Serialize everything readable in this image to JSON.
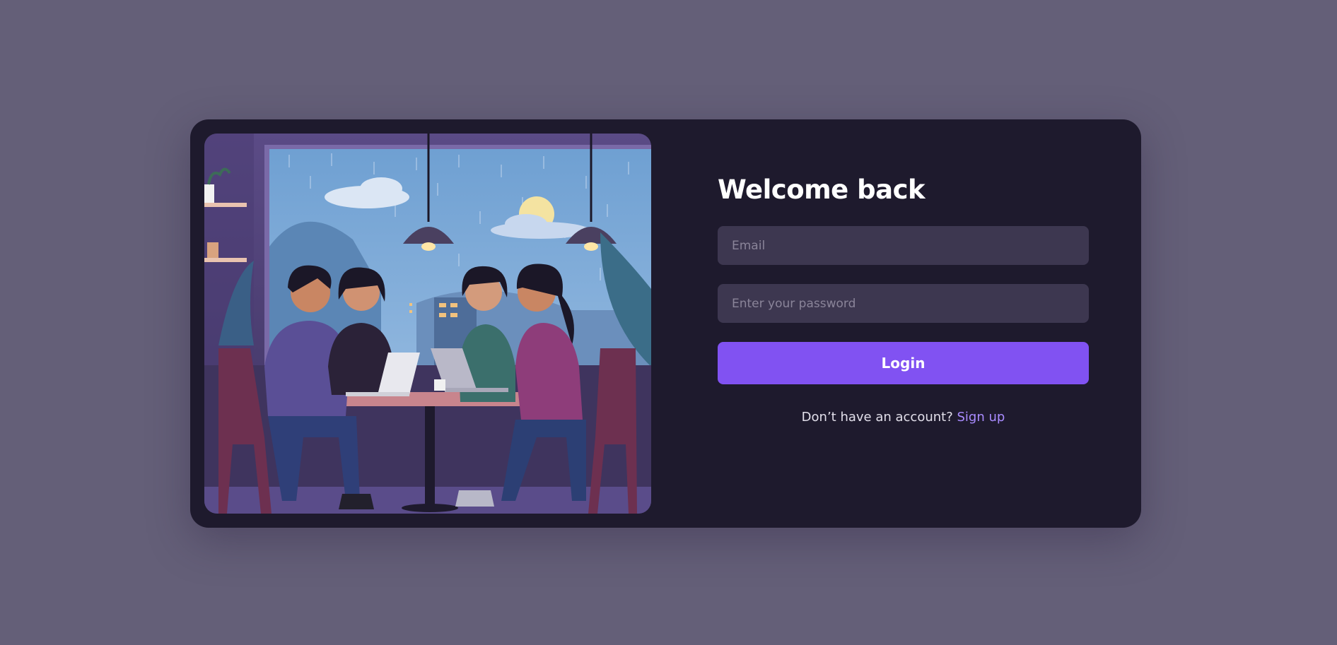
{
  "login": {
    "title": "Welcome back",
    "email_placeholder": "Email",
    "password_placeholder": "Enter your password",
    "login_label": "Login",
    "signup_prompt": "Don’t have an account?",
    "signup_link": "Sign up"
  },
  "colors": {
    "page_background": "#645f78",
    "card_background": "#1e1a2d",
    "input_background": "#3d3750",
    "accent": "#8152f2",
    "link": "#a98bff"
  }
}
